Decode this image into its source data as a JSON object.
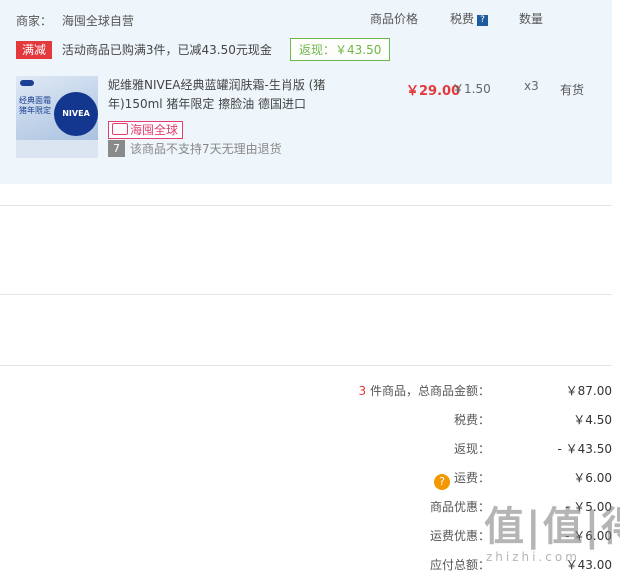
{
  "header": {
    "merchant_label": "商家：",
    "merchant_name": "海囤全球自营",
    "col_price": "商品价格",
    "col_tax": "税费",
    "col_tax_help": "?",
    "col_qty": "数量"
  },
  "promo": {
    "badge": "满减",
    "text": "活动商品已购满3件，已减43.50元现金",
    "rebate": "返现：￥43.50"
  },
  "product": {
    "image_text": {
      "line1": "经典面霜",
      "line2": "猪年限定",
      "brand": "NIVEA"
    },
    "title": "妮维雅NIVEA经典蓝罐润肤霜-生肖版 (猪年)150ml 猪年限定 擦脸油 德国进口",
    "tag": "海囤全球",
    "return_icon": "7",
    "return_policy": "该商品不支持7天无理由退货",
    "price": "￥29.00",
    "tax": "￥1.50",
    "qty": "x3",
    "stock": "有货"
  },
  "summary": {
    "count": "3",
    "total_label": "件商品，总商品金额：",
    "total_value": "￥87.00",
    "tax_label": "税费：",
    "tax_value": "￥4.50",
    "rebate_label": "返现：",
    "rebate_value": "- ￥43.50",
    "shipping_label": "运费：",
    "shipping_value": "￥6.00",
    "product_discount_label": "商品优惠：",
    "product_discount_value": "- ￥5.00",
    "shipping_discount_label": "运费优惠：",
    "shipping_discount_value": "- ￥6.00",
    "payable_label": "应付总额：",
    "payable_value": "￥43.00"
  },
  "watermark": {
    "big": "值|值|得",
    "small": "zhizhi.com"
  },
  "colors": {
    "accent_red": "#e4393c",
    "rebate_green": "#6db84b",
    "panel_bg": "#eef6fb",
    "help_orange": "#f39800"
  }
}
